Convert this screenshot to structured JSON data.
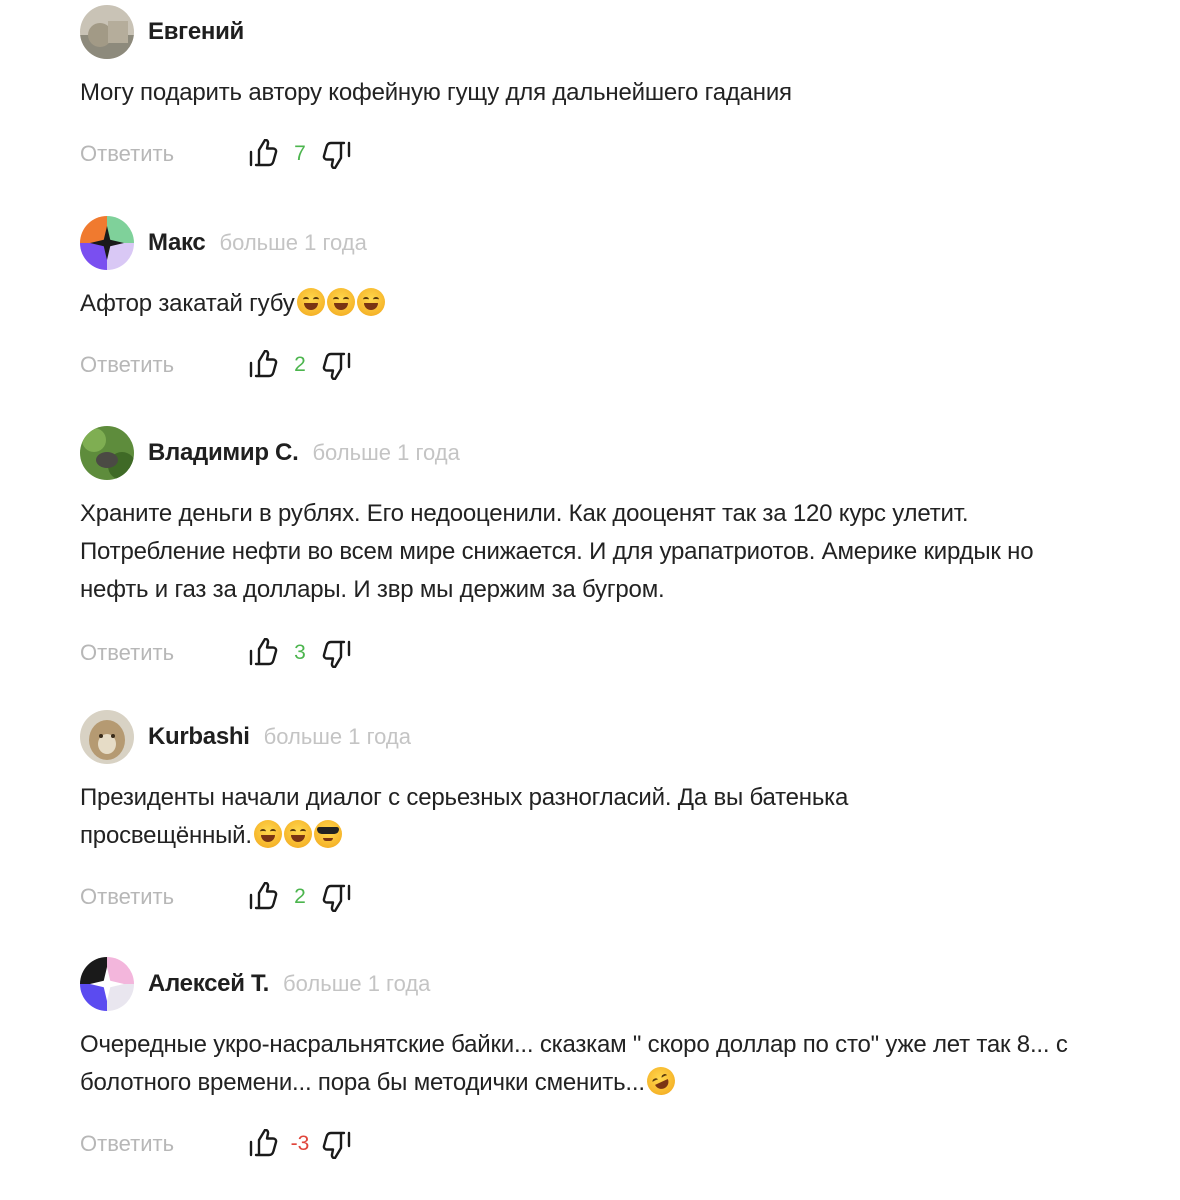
{
  "comments": [
    {
      "author": "Евгений",
      "time": "",
      "text": "Могу подарить автору кофейную гущу для дальнейшего гадания",
      "emojis": [],
      "reply_label": "Ответить",
      "likes": "7",
      "likes_sign": "positive",
      "avatar": "photo-landscape"
    },
    {
      "author": "Макс",
      "time": "больше 1 года",
      "text": "Афтор закатай губу",
      "emojis": [
        "laughing-face",
        "laughing-face",
        "laughing-face"
      ],
      "reply_label": "Ответить",
      "likes": "2",
      "likes_sign": "positive",
      "avatar": "generated-orange-green-purple"
    },
    {
      "author": "Владимир С.",
      "time": "больше 1 года",
      "text": "Храните деньги в рублях. Его недооценили. Как дооценят так за 120 курс улетит. Потребление нефти во всем мире снижается. И для урапатриотов. Америке кирдык но нефть и газ за доллары. И звр мы держим за бугром.",
      "emojis": [],
      "reply_label": "Ответить",
      "likes": "3",
      "likes_sign": "positive",
      "avatar": "photo-green-nature"
    },
    {
      "author": "Kurbashi",
      "time": "больше 1 года",
      "text": "Президенты начали диалог с серьезных разногласий. Да вы батенька просвещённый.",
      "emojis": [
        "laughing-face",
        "laughing-face",
        "sunglasses-face"
      ],
      "reply_label": "Ответить",
      "likes": "2",
      "likes_sign": "positive",
      "avatar": "photo-lion"
    },
    {
      "author": "Алексей Т.",
      "time": "больше 1 года",
      "text": "Очередные укро-насральнятские байки... сказкам \" скоро доллар по сто\" уже лет так 8... с болотного времени... пора бы методички сменить...",
      "emojis": [
        "rolling-laughing-face"
      ],
      "reply_label": "Ответить",
      "likes": "-3",
      "likes_sign": "negative",
      "avatar": "generated-pink-blue-black"
    }
  ],
  "colors": {
    "positive": "#4cb54e",
    "negative": "#e0453b",
    "muted": "#b7b7b7",
    "time": "#c4c4c4"
  },
  "icons": {
    "like": "thumb-up-icon",
    "dislike": "thumb-down-icon"
  }
}
